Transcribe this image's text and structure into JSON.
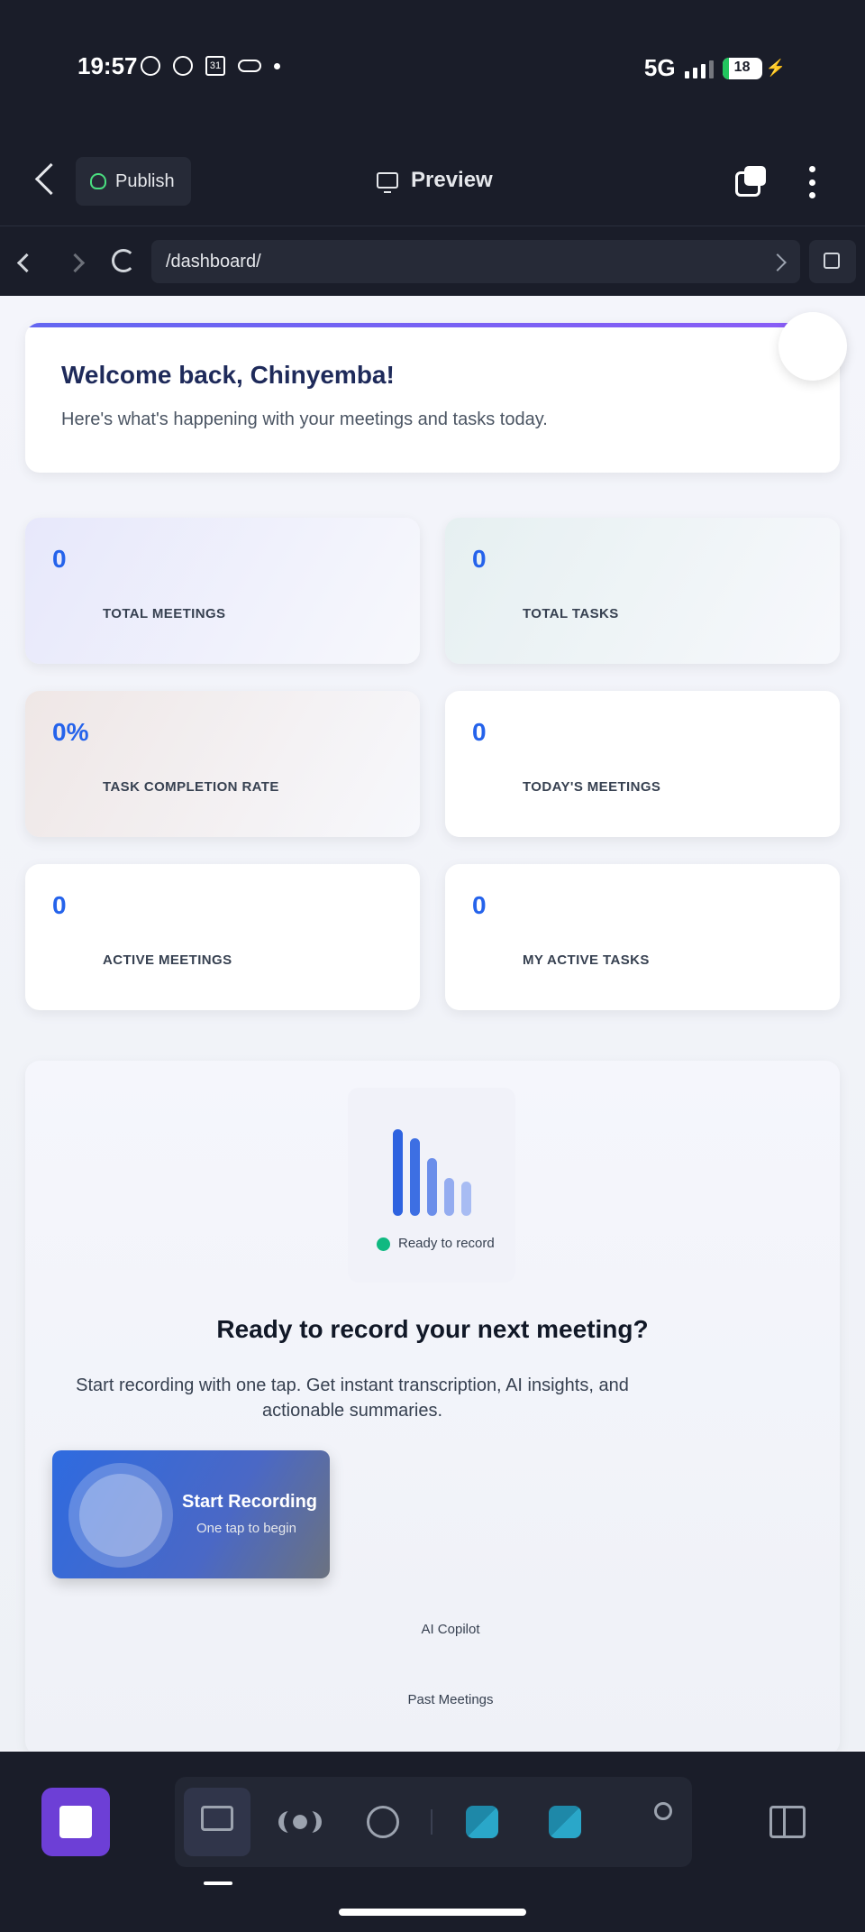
{
  "status_bar": {
    "time": "19:57",
    "calendar_day": "31",
    "network": "5G",
    "battery": "18",
    "battery_level": 0.18
  },
  "app_header": {
    "publish_label": "Publish",
    "preview_label": "Preview"
  },
  "browser": {
    "url": "/dashboard/"
  },
  "welcome": {
    "title": "Welcome back, Chinyemba!",
    "subtitle": "Here's what's happening with your meetings and tasks today."
  },
  "stats": [
    {
      "value": "0",
      "label": "TOTAL MEETINGS",
      "bg": "#e7e8fb"
    },
    {
      "value": "0",
      "label": "TOTAL TASKS",
      "bg": "#e6f0f1"
    },
    {
      "value": "0%",
      "label": "TASK COMPLETION RATE",
      "bg": "#efe7e6"
    },
    {
      "value": "0",
      "label": "TODAY'S MEETINGS",
      "bg": "#ffffff"
    },
    {
      "value": "0",
      "label": "ACTIVE MEETINGS",
      "bg": "#ffffff"
    },
    {
      "value": "0",
      "label": "MY ACTIVE TASKS",
      "bg": "#ffffff"
    }
  ],
  "recorder": {
    "status": "Ready to record",
    "title": "Ready to record your next meeting?",
    "description": "Start recording with one tap. Get instant transcription, AI insights, and actionable summaries.",
    "start_label": "Start Recording",
    "start_sub": "One tap to begin",
    "ai_copilot": "AI Copilot",
    "past_meetings": "Past Meetings"
  },
  "dock": {
    "icons": [
      "monitor-icon",
      "cluster-icon",
      "globe-icon",
      "python-icon",
      "python-icon",
      "graph-icon"
    ]
  },
  "colors": {
    "accent": "#2563eb",
    "stop_button": "#6d3fd6",
    "ready_dot": "#10b981"
  }
}
